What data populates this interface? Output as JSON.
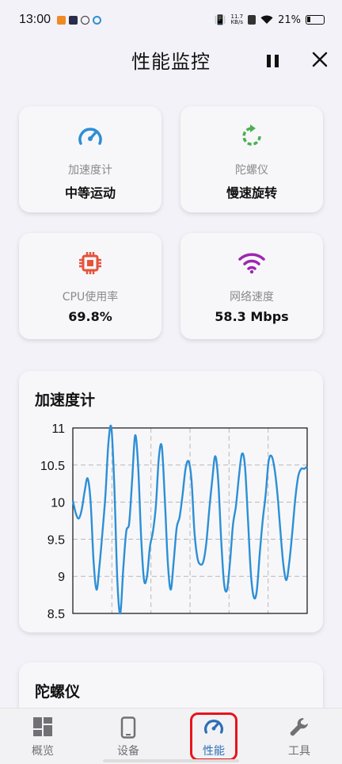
{
  "status_bar": {
    "time": "13:00",
    "net_speed_value": "11.7",
    "net_speed_unit": "KB/s",
    "battery": "21%"
  },
  "header": {
    "title": "性能监控",
    "pause_icon": "pause-icon",
    "close_icon": "close-icon"
  },
  "cards": [
    {
      "label": "加速度计",
      "value": "中等运动",
      "icon": "speedometer-icon",
      "color": "#2d8fd5"
    },
    {
      "label": "陀螺仪",
      "value": "慢速旋转",
      "icon": "rotate-icon",
      "color": "#4caf50"
    },
    {
      "label": "CPU使用率",
      "value": "69.8%",
      "icon": "cpu-icon",
      "color": "#e5533b"
    },
    {
      "label": "网络速度",
      "value": "58.3 Mbps",
      "icon": "wifi-icon",
      "color": "#9c27b0"
    }
  ],
  "accel_chart": {
    "title": "加速度计"
  },
  "gyro_chart": {
    "title": "陀螺仪"
  },
  "chart_data": {
    "type": "line",
    "ylim": [
      8.5,
      11
    ],
    "yticks": [
      "8.5",
      "9",
      "9.5",
      "10",
      "10.5",
      "11"
    ],
    "grid": true,
    "color": "#2d8fd5",
    "x": [
      0,
      1,
      2,
      3,
      4,
      5,
      6,
      7,
      8,
      9,
      10,
      11,
      12,
      13,
      14,
      15,
      16,
      17,
      18,
      19,
      20,
      21,
      22,
      23,
      24,
      25,
      26,
      27,
      28,
      29,
      30,
      31,
      32,
      33,
      34,
      35,
      36,
      37,
      38,
      39,
      40,
      41,
      42,
      43,
      44,
      45,
      46,
      47,
      48,
      49,
      50,
      51,
      52,
      53,
      54,
      55,
      56,
      57,
      58,
      59,
      60,
      61,
      62,
      63,
      64,
      65,
      66,
      67,
      68,
      69,
      70,
      71,
      72,
      73,
      74,
      75,
      76,
      77,
      78,
      79
    ],
    "values": [
      10.02,
      9.85,
      9.78,
      9.9,
      10.15,
      10.32,
      10.0,
      9.2,
      8.82,
      9.15,
      9.6,
      10.1,
      10.8,
      11.0,
      10.2,
      8.95,
      8.5,
      9.1,
      9.6,
      9.72,
      10.3,
      10.9,
      10.5,
      9.55,
      8.95,
      9.0,
      9.4,
      9.6,
      9.95,
      10.6,
      10.75,
      10.05,
      9.2,
      8.82,
      9.2,
      9.65,
      9.8,
      10.1,
      10.45,
      10.55,
      10.3,
      9.6,
      9.25,
      9.16,
      9.2,
      9.45,
      9.9,
      10.3,
      10.62,
      10.3,
      9.5,
      8.9,
      8.82,
      9.2,
      9.7,
      9.95,
      10.35,
      10.65,
      10.5,
      9.8,
      9.05,
      8.72,
      8.8,
      9.3,
      9.75,
      10.1,
      10.55,
      10.62,
      10.45,
      10.1,
      9.6,
      9.15,
      8.95,
      9.2,
      9.6,
      10.05,
      10.35,
      10.45,
      10.45,
      10.48
    ]
  },
  "bottom_nav": [
    {
      "label": "概览",
      "icon": "dashboard-icon",
      "active": false
    },
    {
      "label": "设备",
      "icon": "phone-icon",
      "active": false
    },
    {
      "label": "性能",
      "icon": "speedometer-icon",
      "active": true
    },
    {
      "label": "工具",
      "icon": "wrench-icon",
      "active": false
    }
  ]
}
